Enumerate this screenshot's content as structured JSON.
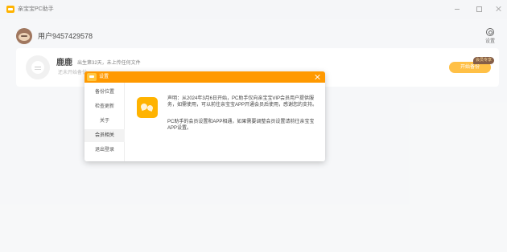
{
  "window": {
    "title": "亲宝宝PC助手",
    "controls": [
      "minimize",
      "maximize",
      "close"
    ]
  },
  "user": {
    "name": "用户9457429578",
    "settings_label": "设置"
  },
  "baby": {
    "name": "鹿鹿",
    "desc": "出生第32天，未上传任何文件",
    "sub": "还未开始备份"
  },
  "vip": {
    "badge": "会员专享",
    "button": "开始备份"
  },
  "dialog": {
    "title": "设置",
    "menu": [
      {
        "label": "备份位置",
        "active": false
      },
      {
        "label": "检查更新",
        "active": false
      },
      {
        "label": "关于",
        "active": false
      },
      {
        "label": "会员相关",
        "active": true
      },
      {
        "label": "退出登录",
        "active": false
      }
    ],
    "notice": "声明：从2024年3月6日开始，PC助手仅向亲宝宝VIP会员用户提供服务，如需使用，可以前往亲宝宝APP开通会员后使用，感谢您的支持。",
    "notice2": "PC助手的会员设置和APP相通，如果需要调整会员设置请前往亲宝宝APP设置。"
  },
  "colors": {
    "accent": "#ff9900",
    "button": "#ffb21e",
    "vip_badge": "#6b3b1f"
  }
}
